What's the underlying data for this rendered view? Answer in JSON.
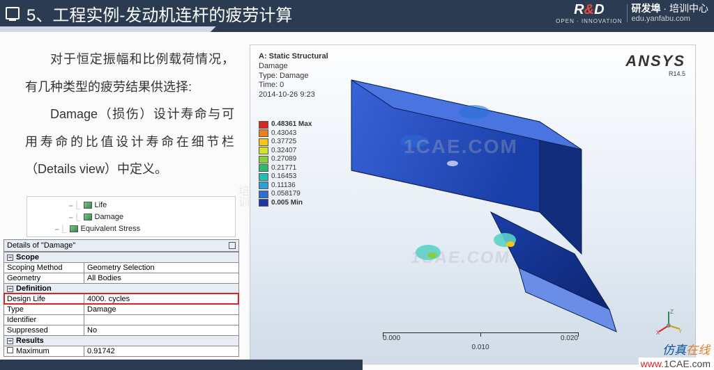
{
  "header": {
    "title": "5、工程实例-发动机连杆的疲劳计算",
    "brand": {
      "name": "研发埠",
      "sub": "培训中心",
      "url": "edu.yanfabu.com",
      "tag": "OPEN · INNOVATION"
    }
  },
  "body_text": {
    "p1": "对于恒定振幅和比例载荷情况，有几种类型的疲劳结果供选择:",
    "p2": "Damage（损伤）设计寿命与可用寿命的比值设计寿命在细节栏（Details view）中定义。"
  },
  "tree": {
    "items": [
      "Life",
      "Damage",
      "Equivalent Stress"
    ]
  },
  "details": {
    "title": "Details of \"Damage\"",
    "sections": [
      {
        "name": "Scope",
        "rows": [
          {
            "label": "Scoping Method",
            "value": "Geometry Selection"
          },
          {
            "label": "Geometry",
            "value": "All Bodies"
          }
        ]
      },
      {
        "name": "Definition",
        "rows": [
          {
            "label": "Design Life",
            "value": "4000. cycles",
            "hl": true
          },
          {
            "label": "Type",
            "value": "Damage"
          },
          {
            "label": "Identifier",
            "value": ""
          },
          {
            "label": "Suppressed",
            "value": "No"
          }
        ]
      },
      {
        "name": "Results",
        "rows": [
          {
            "label": "Maximum",
            "value": "0.91742",
            "box": true
          }
        ]
      }
    ]
  },
  "viewport": {
    "info": {
      "title": "A: Static Structural",
      "result": "Damage",
      "type": "Type: Damage",
      "time": "Time: 0",
      "date": "2014-10-26 9:23"
    },
    "brand": {
      "name": "ANSYS",
      "release": "R14.5"
    },
    "legend": [
      {
        "label": "0.48361 Max",
        "color": "#d8261c",
        "bold": true
      },
      {
        "label": "0.43043",
        "color": "#ef7f1a"
      },
      {
        "label": "0.37725",
        "color": "#f5c518"
      },
      {
        "label": "0.32407",
        "color": "#d6e22a"
      },
      {
        "label": "0.27089",
        "color": "#86d13a"
      },
      {
        "label": "0.21771",
        "color": "#2eb872"
      },
      {
        "label": "0.16453",
        "color": "#1fbfb8"
      },
      {
        "label": "0.11136",
        "color": "#29a0d8"
      },
      {
        "label": "0.058179",
        "color": "#2b6fd6"
      },
      {
        "label": "0.005 Min",
        "color": "#1a36a8",
        "bold": true
      }
    ],
    "scale": {
      "a": "0.000",
      "b": "0.020",
      "mid": "0.010"
    },
    "triad": {
      "x": "X",
      "y": "Y",
      "z": "Z"
    },
    "wm": "1CAE.COM"
  },
  "footer": {
    "brand_cn": "仿真在线",
    "url_w": "www.",
    "url_rest": "1CAE.com",
    "strip": ""
  },
  "side_wm": "培训"
}
